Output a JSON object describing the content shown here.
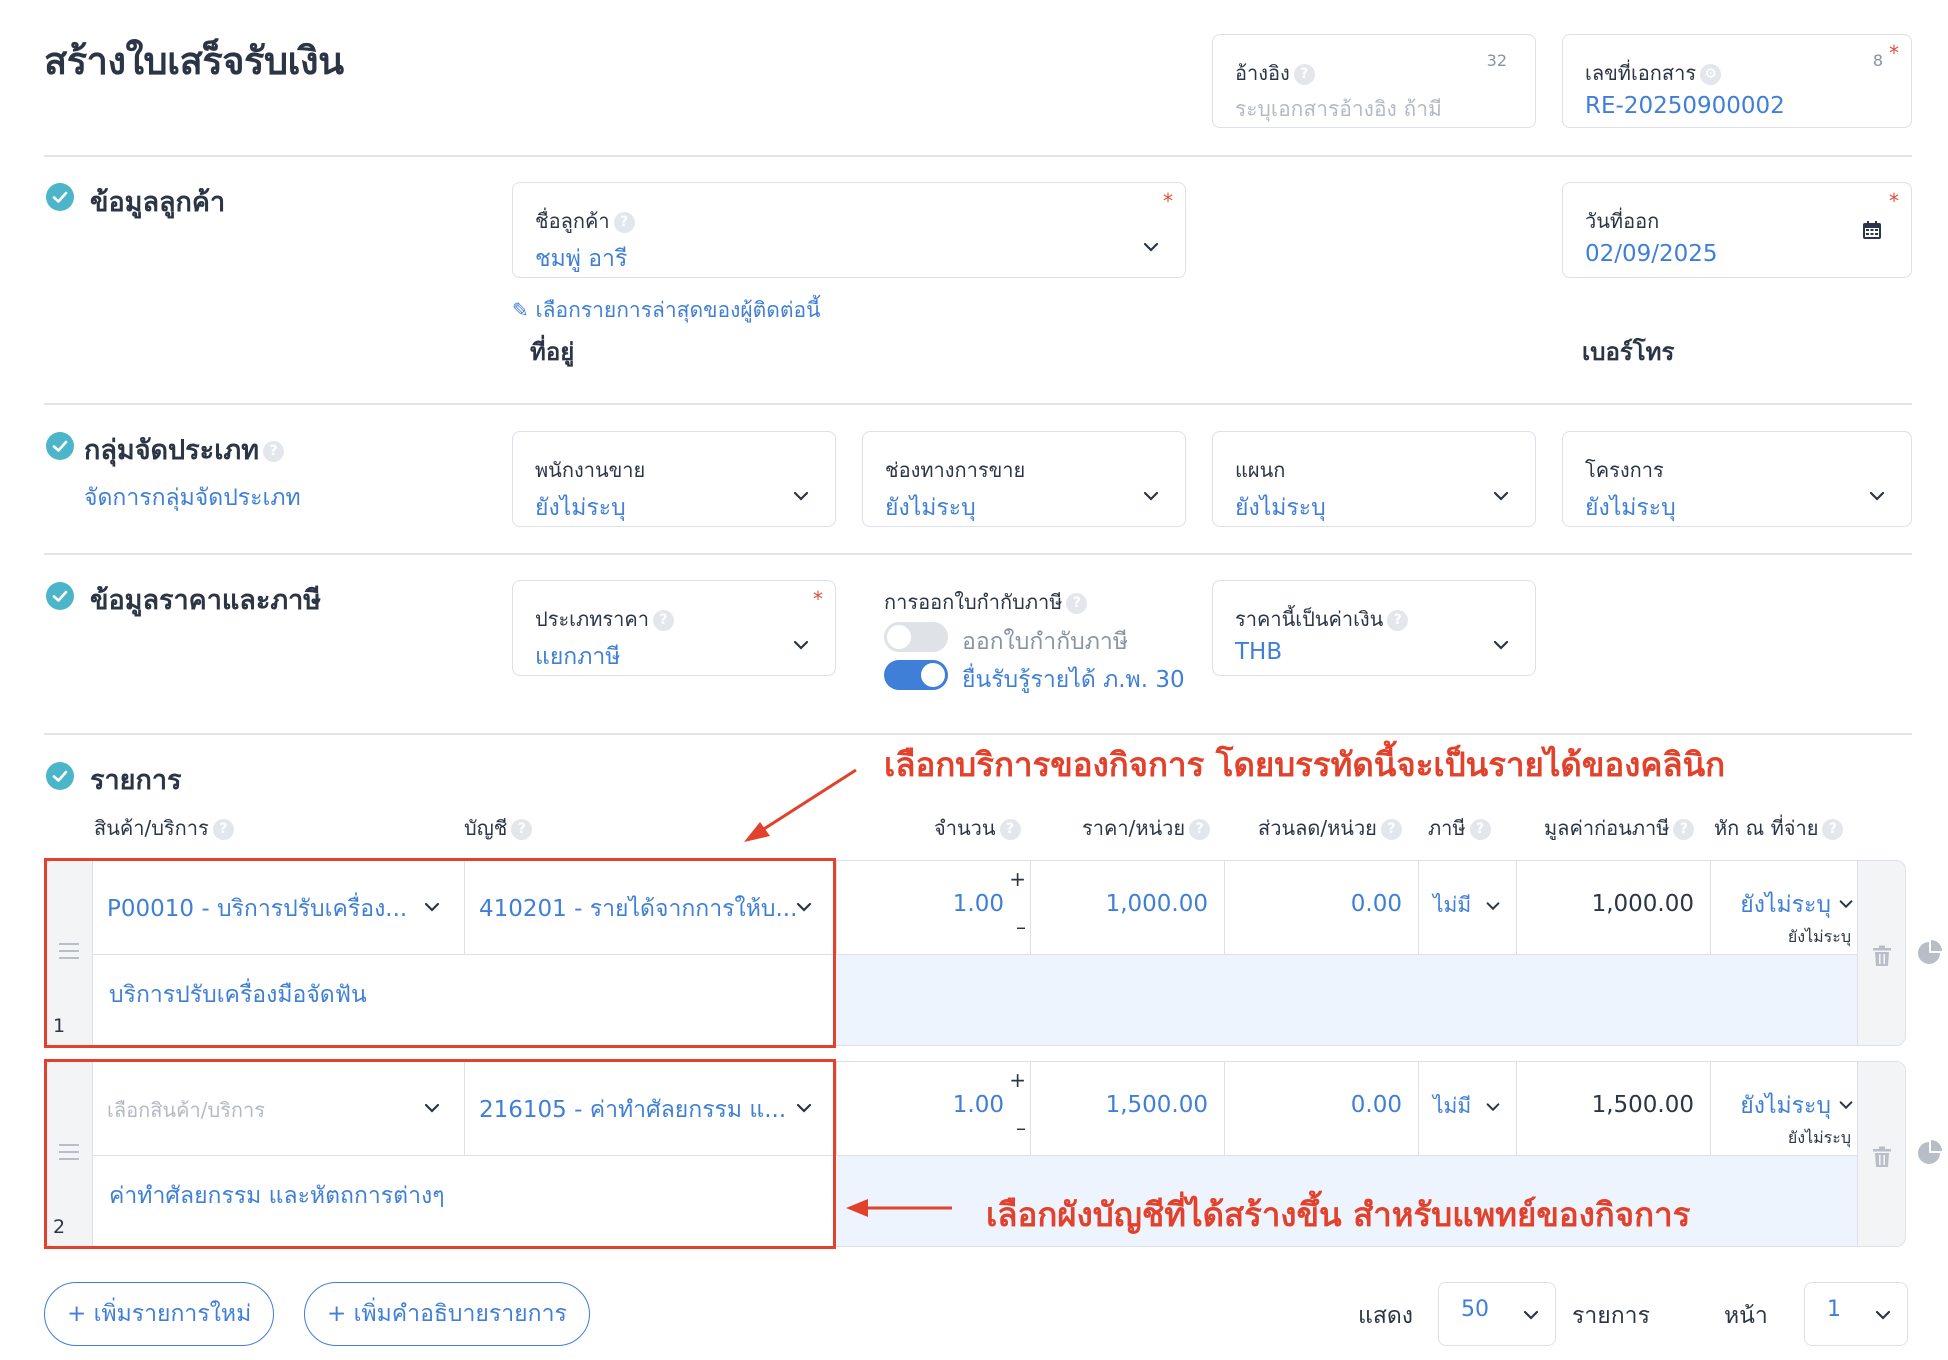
{
  "header": {
    "title": "สร้างใบเสร็จรับเงิน",
    "reference": {
      "label": "อ้างอิง",
      "placeholder": "ระบุเอกสารอ้างอิง ถ้ามี",
      "counter": "32"
    },
    "doc_number": {
      "label": "เลขที่เอกสาร",
      "value": "RE-20250900002",
      "counter": "8",
      "required": "*"
    }
  },
  "customer": {
    "section_title": "ข้อมูลลูกค้า",
    "name_label": "ชื่อลูกค้า",
    "name_value": "ชมพู่ อารี",
    "required": "*",
    "recent_link": "เลือกรายการล่าสุดของผู้ติดต่อนี้",
    "address_label": "ที่อยู่",
    "phone_label": "เบอร์โทร",
    "issue_date_label": "วันที่ออก",
    "issue_date_value": "02/09/2025"
  },
  "group": {
    "section_title": "กลุ่มจัดประเภท",
    "manage_link": "จัดการกลุ่มจัดประเภท",
    "fields": [
      {
        "label": "พนักงานขาย",
        "value": "ยังไม่ระบุ"
      },
      {
        "label": "ช่องทางการขาย",
        "value": "ยังไม่ระบุ"
      },
      {
        "label": "แผนก",
        "value": "ยังไม่ระบุ"
      },
      {
        "label": "โครงการ",
        "value": "ยังไม่ระบุ"
      }
    ]
  },
  "pricing": {
    "section_title": "ข้อมูลราคาและภาษี",
    "price_type_label": "ประเภทราคา",
    "price_type_value": "แยกภาษี",
    "required": "*",
    "tax_invoice_label": "การออกใบกำกับภาษี",
    "toggle_tax_invoice": {
      "label": "ออกใบกำกับภาษี",
      "on": false
    },
    "toggle_pp30": {
      "label": "ยื่นรับรู้รายได้ ภ.พ. 30",
      "on": true
    },
    "currency_label": "ราคานี้เป็นค่าเงิน",
    "currency_value": "THB"
  },
  "items": {
    "section_title": "รายการ",
    "columns": [
      "สินค้า/บริการ",
      "บัญชี",
      "จำนวน",
      "ราคา/หน่วย",
      "ส่วนลด/หน่วย",
      "ภาษี",
      "มูลค่าก่อนภาษี",
      "หัก ณ ที่จ่าย"
    ],
    "rows": [
      {
        "no": "1",
        "product": "P00010 - บริการปรับเครื่อง...",
        "product_placeholder": false,
        "account": "410201 - รายได้จากการให้บ...",
        "qty": "1.00",
        "price": "1,000.00",
        "discount": "0.00",
        "tax": "ไม่มี",
        "amount": "1,000.00",
        "wht": "ยังไม่ระบุ",
        "wht_sub": "ยังไม่ระบุ",
        "description": "บริการปรับเครื่องมือจัดฟัน"
      },
      {
        "no": "2",
        "product": "เลือกสินค้า/บริการ",
        "product_placeholder": true,
        "account": "216105 - ค่าทำศัลยกรรม แ...",
        "qty": "1.00",
        "price": "1,500.00",
        "discount": "0.00",
        "tax": "ไม่มี",
        "amount": "1,500.00",
        "wht": "ยังไม่ระบุ",
        "wht_sub": "ยังไม่ระบุ",
        "description": "ค่าทำศัลยกรรม และหัตถการต่างๆ"
      }
    ],
    "plus": "+",
    "minus": "–"
  },
  "annotations": {
    "top": "เลือกบริการของกิจการ โดยบรรทัดนี้จะเป็นรายได้ของคลินิก",
    "bottom": "เลือกผังบัญชีที่ได้สร้างขึ้น สำหรับแพทย์ของกิจการ"
  },
  "footer": {
    "add_item_button": "+ เพิ่มรายการใหม่",
    "add_desc_button": "+ เพิ่มคำอธิบายรายการ",
    "show_label": "แสดง",
    "per_page": "50",
    "items_label": "รายการ",
    "page_label": "หน้า",
    "page_value": "1"
  },
  "colors": {
    "accent": "#3f7fd7",
    "check": "#4cb5c9",
    "annotation": "#e2412c",
    "toggle_on": "#3f7fd7",
    "toggle_off": "#dfe2e7"
  }
}
